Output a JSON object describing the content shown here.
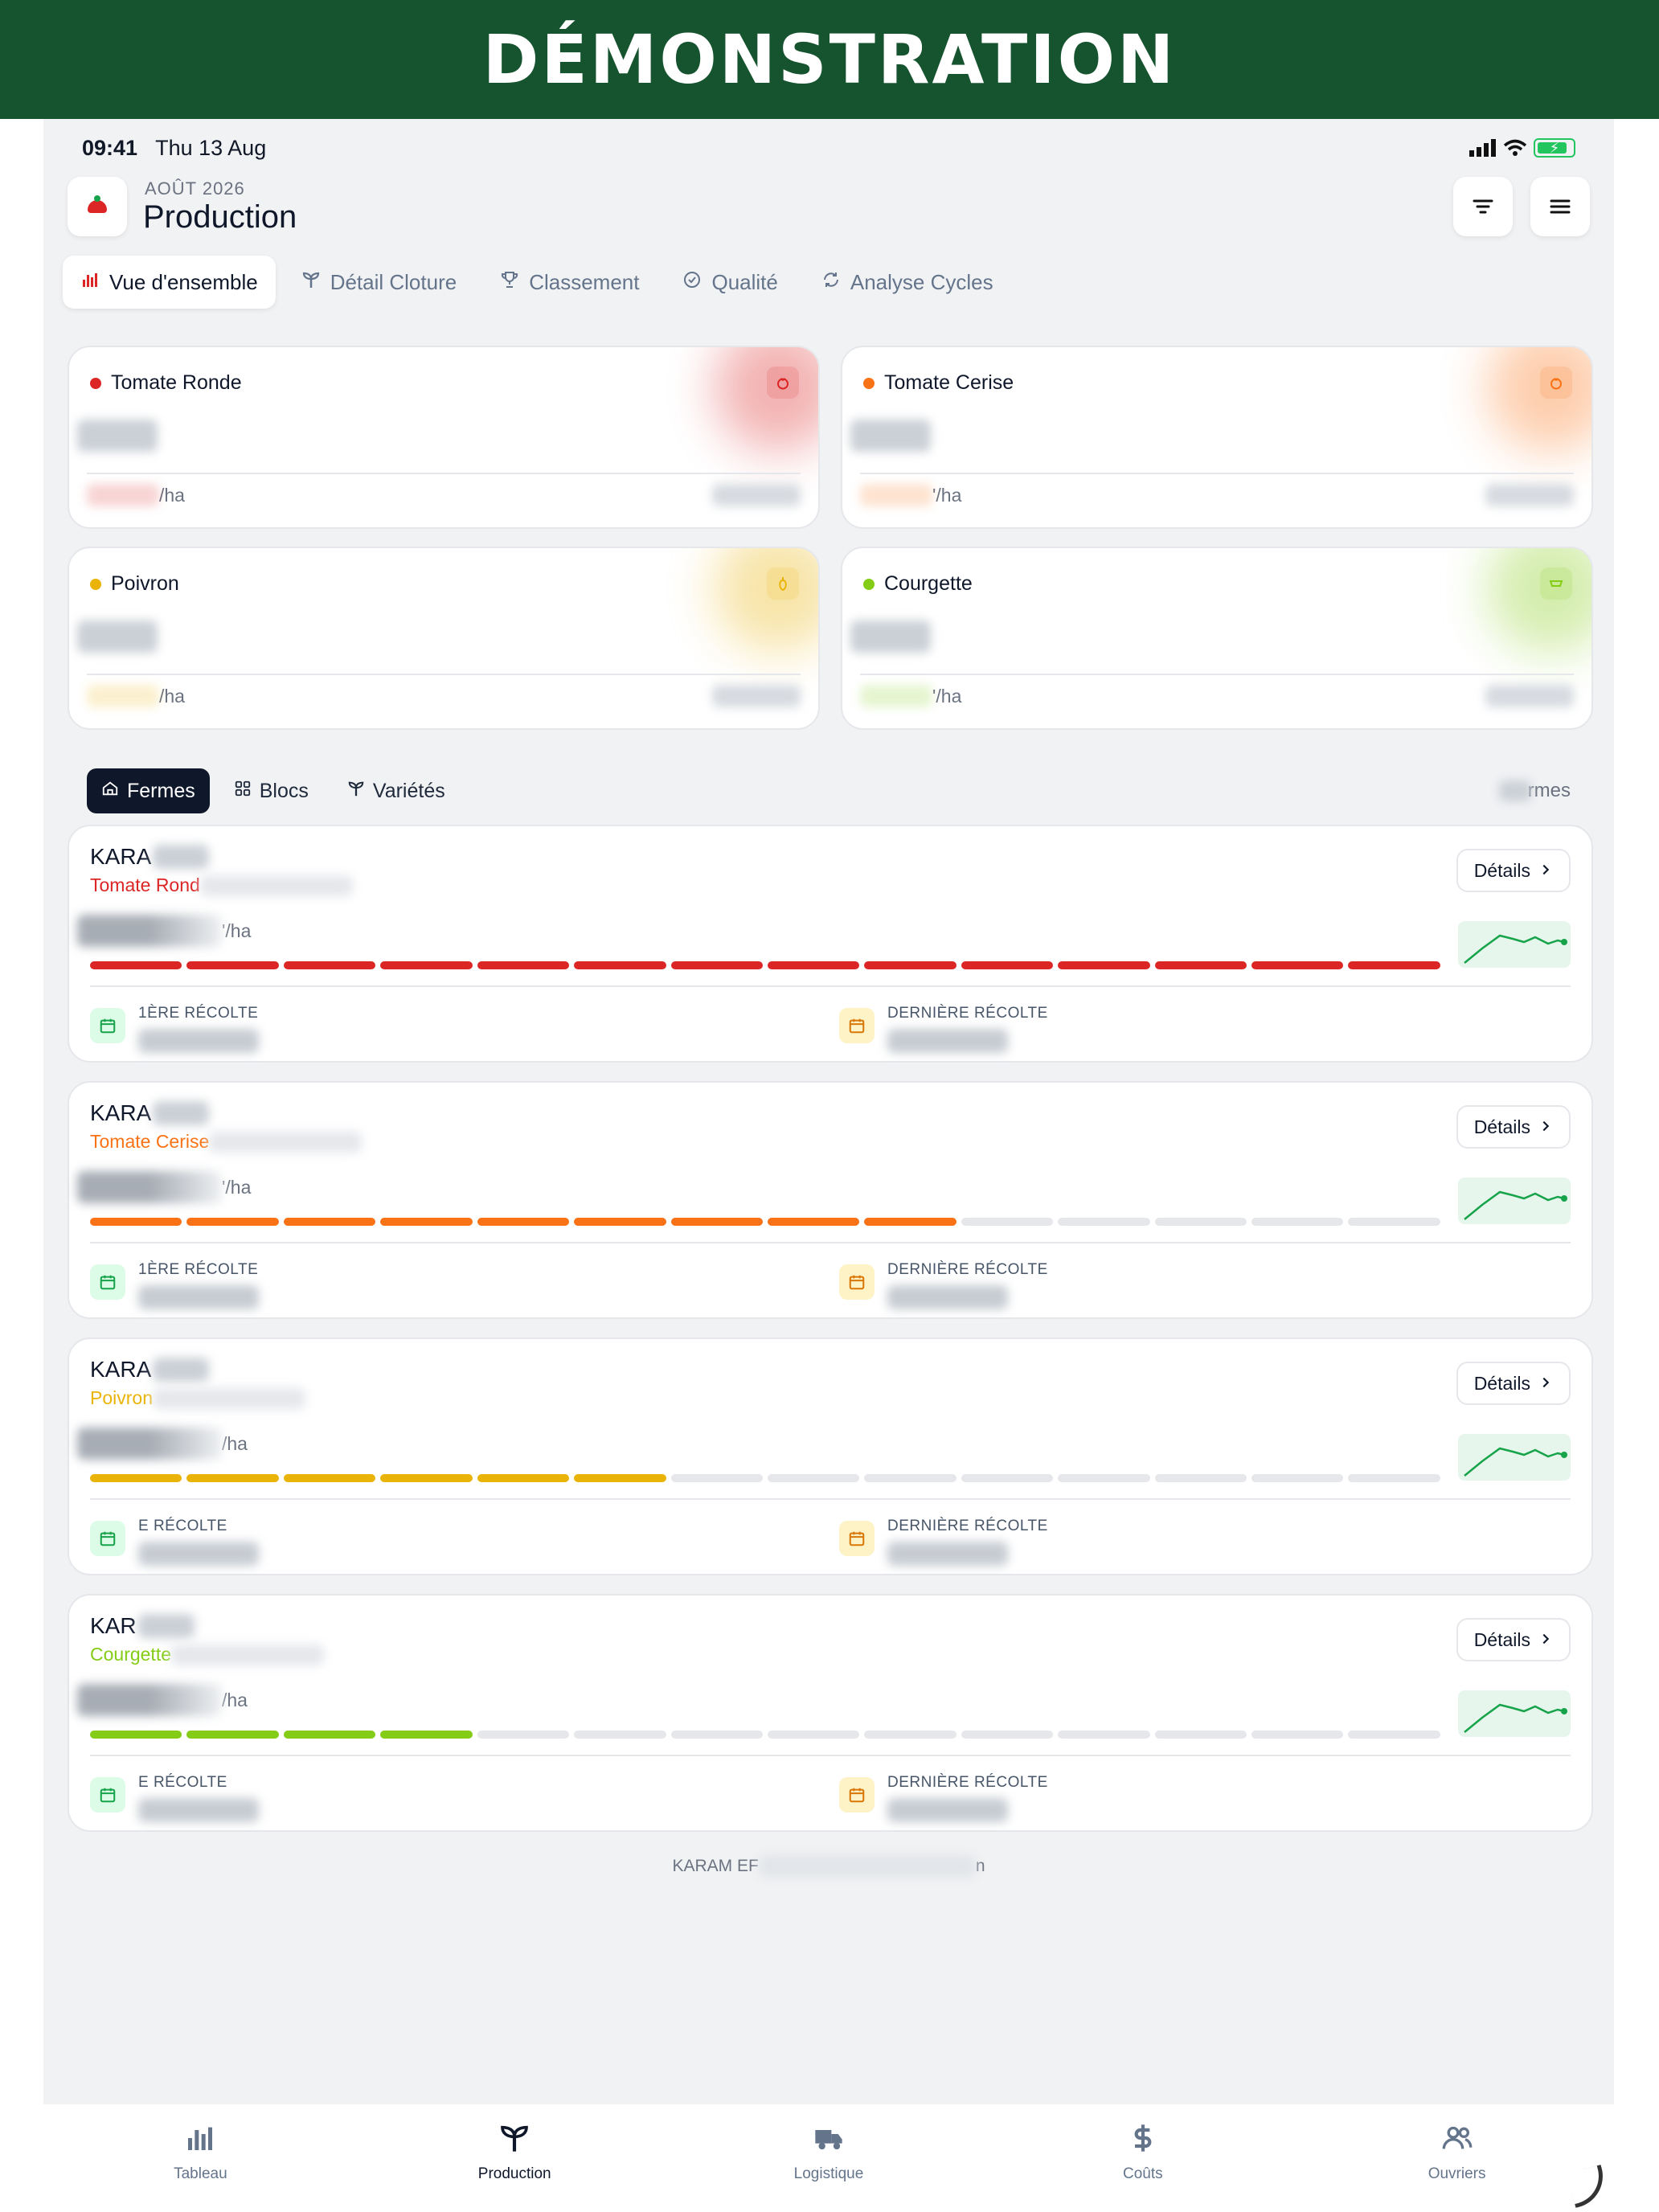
{
  "banner": {
    "text": "DÉMONSTRATION",
    "bg": "#16532f"
  },
  "status": {
    "time": "09:41",
    "date": "Thu 13 Aug"
  },
  "header": {
    "month": "AOÛT 2026",
    "title": "Production"
  },
  "tabs": [
    {
      "label": "Vue d'ensemble",
      "icon": "bar-chart-icon",
      "active": true
    },
    {
      "label": "Détail Cloture",
      "icon": "sprout-icon"
    },
    {
      "label": "Classement",
      "icon": "trophy-icon"
    },
    {
      "label": "Qualité",
      "icon": "badge-check-icon"
    },
    {
      "label": "Analyse Cycles",
      "icon": "refresh-icon"
    }
  ],
  "crops": [
    {
      "name": "Tomate Ronde",
      "color": "#dc2626",
      "unit": "/ha",
      "icon": "tomato-icon"
    },
    {
      "name": "Tomate Cerise",
      "color": "#f97316",
      "unit": "'/ha",
      "icon": "tomato-icon"
    },
    {
      "name": "Poivron",
      "color": "#eab308",
      "unit": "/ha",
      "icon": "pepper-icon"
    },
    {
      "name": "Courgette",
      "color": "#84cc16",
      "unit": "'/ha",
      "icon": "zucchini-icon"
    }
  ],
  "sub_tabs": [
    {
      "label": "Fermes",
      "icon": "farm-icon",
      "active": true
    },
    {
      "label": "Blocs",
      "icon": "grid-icon"
    },
    {
      "label": "Variétés",
      "icon": "sprout-icon"
    }
  ],
  "farms_count_suffix": "rmes",
  "farms": [
    {
      "name": "KARA",
      "crop": "Tomate Rond",
      "crop_color": "#dc2626",
      "yield_unit": "'/ha",
      "filled": 14,
      "first_label": "1ÈRE RÉCOLTE",
      "last_label": "DERNIÈRE RÉCOLTE",
      "details": "Détails"
    },
    {
      "name": "KARA",
      "crop": "Tomate Cerise",
      "crop_color": "#f97316",
      "yield_unit": "'/ha",
      "filled": 9,
      "first_label": "1ÈRE RÉCOLTE",
      "last_label": "DERNIÈRE RÉCOLTE",
      "details": "Détails"
    },
    {
      "name": "KARA",
      "crop": "Poivron",
      "crop_color": "#eab308",
      "yield_unit": "/ha",
      "filled": 6,
      "first_label": "E RÉCOLTE",
      "last_label": "DERNIÈRE RÉCOLTE",
      "details": "Détails"
    },
    {
      "name": "KAR",
      "crop": "Courgette",
      "crop_color": "#84cc16",
      "yield_unit": "/ha",
      "filled": 4,
      "first_label": "E RÉCOLTE",
      "last_label": "DERNIÈRE RÉCOLTE",
      "details": "Détails"
    }
  ],
  "bar_total": 14,
  "footer_note": {
    "start": "KARAM EF",
    "end": "n"
  },
  "nav": [
    {
      "label": "Tableau",
      "icon": "bar-chart-icon"
    },
    {
      "label": "Production",
      "icon": "sprout-icon",
      "active": true
    },
    {
      "label": "Logistique",
      "icon": "truck-icon"
    },
    {
      "label": "Coûts",
      "icon": "dollar-icon"
    },
    {
      "label": "Ouvriers",
      "icon": "users-icon"
    }
  ]
}
